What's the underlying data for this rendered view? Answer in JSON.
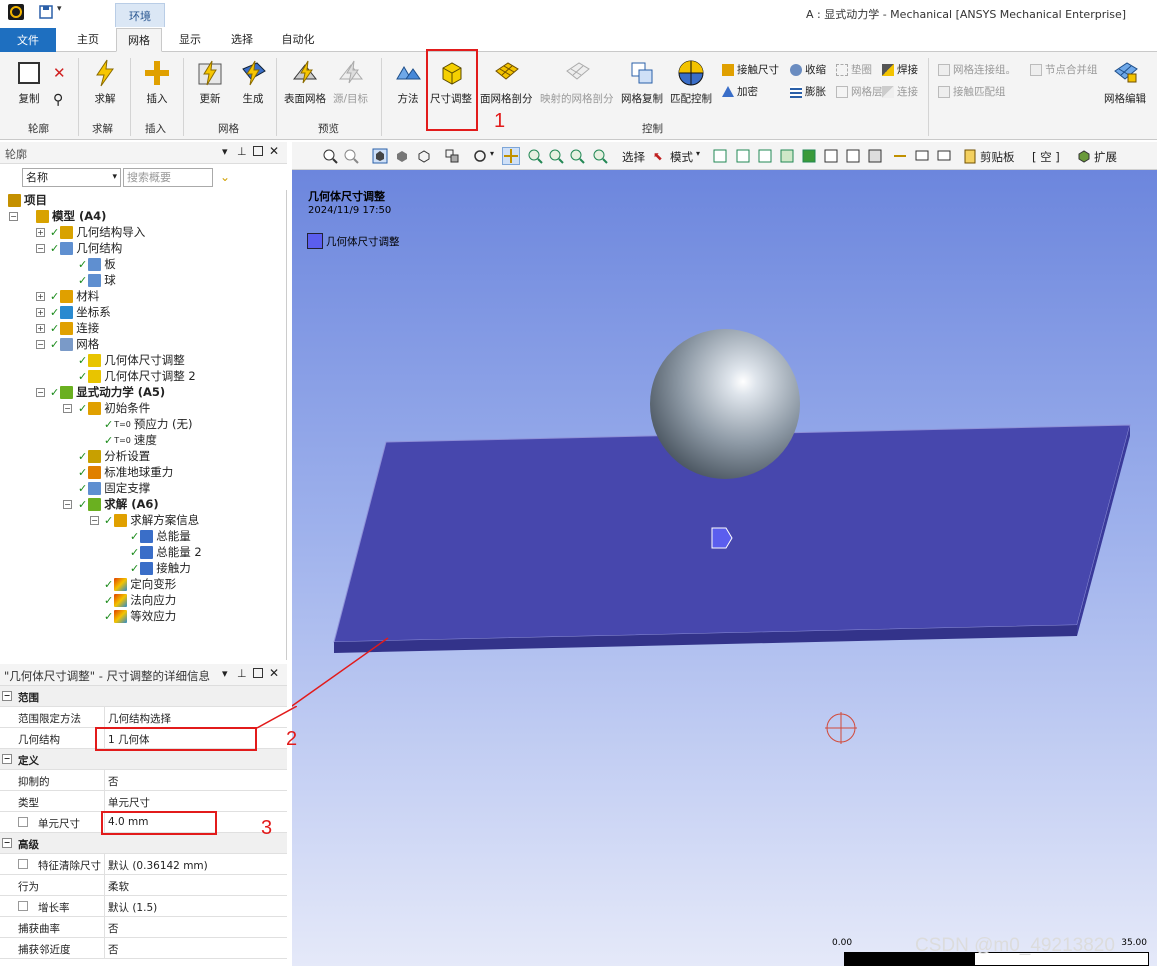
{
  "window": {
    "title": "A : 显式动力学 - Mechanical [ANSYS Mechanical Enterprise]",
    "context_tab": "环境"
  },
  "menu": {
    "file": "文件",
    "tabs": [
      "主页",
      "网格",
      "显示",
      "选择",
      "自动化"
    ],
    "active": "网格"
  },
  "ribbon": {
    "copy": "复制",
    "solve": "求解",
    "insert": "插入",
    "update": "更新",
    "generate": "生成",
    "surface_mesh": "表面网格",
    "source_target": "源/目标",
    "method": "方法",
    "sizing": "尺寸调整",
    "face_meshing": "面网格剖分",
    "mapped_face": "映射的网格剖分",
    "mesh_copy": "网格复制",
    "match_control": "匹配控制",
    "contact_sizing": "接触尺寸",
    "refinement": "加密",
    "pinch": "收缩",
    "inflation": "膨胀",
    "gasket": "垫圈",
    "mesh_layer": "网格层",
    "weld": "焊接",
    "connect": "连接",
    "mesh_connection_group": "网格连接组。",
    "node_merge_group": "节点合并组",
    "contact_match_group": "接触匹配组",
    "mesh_edit": "网格编辑",
    "groups": {
      "outline": "轮廓",
      "solve": "求解",
      "insert": "插入",
      "mesh": "网格",
      "preview": "预览",
      "control": "控制"
    }
  },
  "outline": {
    "title": "轮廓",
    "filter_label": "名称",
    "search_placeholder": "搜索概要",
    "items": [
      {
        "label": "项目"
      },
      {
        "label": "模型 (A4)"
      },
      {
        "label": "几何结构导入"
      },
      {
        "label": "几何结构"
      },
      {
        "label": "板"
      },
      {
        "label": "球"
      },
      {
        "label": "材料"
      },
      {
        "label": "坐标系"
      },
      {
        "label": "连接"
      },
      {
        "label": "网格"
      },
      {
        "label": "几何体尺寸调整"
      },
      {
        "label": "几何体尺寸调整 2"
      },
      {
        "label": "显式动力学 (A5)"
      },
      {
        "label": "初始条件"
      },
      {
        "label": "预应力 (无)"
      },
      {
        "label": "速度"
      },
      {
        "label": "分析设置"
      },
      {
        "label": "标准地球重力"
      },
      {
        "label": "固定支撑"
      },
      {
        "label": "求解 (A6)"
      },
      {
        "label": "求解方案信息"
      },
      {
        "label": "总能量"
      },
      {
        "label": "总能量 2"
      },
      {
        "label": "接触力"
      },
      {
        "label": "定向变形"
      },
      {
        "label": "法向应力"
      },
      {
        "label": "等效应力"
      }
    ]
  },
  "details": {
    "title": "\"几何体尺寸调整\" - 尺寸调整的详细信息",
    "rows": [
      {
        "key": "范围",
        "value": ""
      },
      {
        "key": "范围限定方法",
        "value": "几何结构选择"
      },
      {
        "key": "几何结构",
        "value": "1 几何体"
      },
      {
        "key": "定义",
        "value": ""
      },
      {
        "key": "抑制的",
        "value": "否"
      },
      {
        "key": "类型",
        "value": "单元尺寸"
      },
      {
        "key": "单元尺寸",
        "value": "4.0 mm"
      },
      {
        "key": "高级",
        "value": ""
      },
      {
        "key": "特征清除尺寸",
        "value": "默认 (0.36142 mm)"
      },
      {
        "key": "行为",
        "value": "柔软"
      },
      {
        "key": "增长率",
        "value": "默认 (1.5)"
      },
      {
        "key": "捕获曲率",
        "value": "否"
      },
      {
        "key": "捕获邻近度",
        "value": "否"
      }
    ]
  },
  "view_toolbar": {
    "select": "选择",
    "mode": "模式",
    "clipboard": "剪贴板",
    "empty": "[ 空 ]",
    "expand": "扩展"
  },
  "viewport": {
    "title": "几何体尺寸调整",
    "date": "2024/11/9 17:50",
    "legend": "几何体尺寸调整",
    "scale_start": "0.00",
    "scale_end": "35.00",
    "colors": {
      "plate": "#4747ad",
      "selection": "#5b5eee",
      "sphere": "#8e9aa6"
    }
  },
  "annotations": {
    "one": "1",
    "two": "2",
    "three": "3"
  },
  "watermark": "CSDN @m0_49213820"
}
